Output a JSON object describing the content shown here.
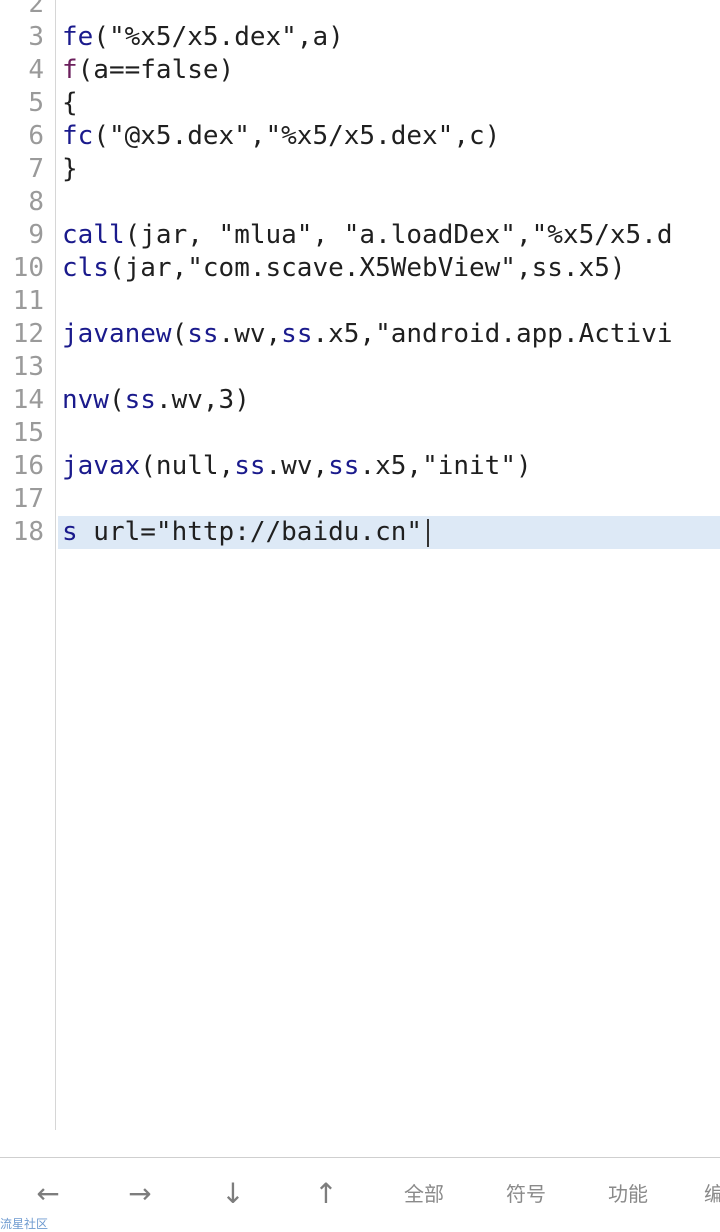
{
  "editor": {
    "lines": [
      {
        "n": "2",
        "tokens": [
          {
            "t": "",
            "c": ""
          }
        ]
      },
      {
        "n": "3",
        "tokens": [
          {
            "t": "fe",
            "c": "kw"
          },
          {
            "t": "(\"%x5/x5.dex\",a)",
            "c": ""
          }
        ]
      },
      {
        "n": "4",
        "tokens": [
          {
            "t": "f",
            "c": "kw2"
          },
          {
            "t": "(a==false)",
            "c": ""
          }
        ]
      },
      {
        "n": "5",
        "tokens": [
          {
            "t": "{",
            "c": ""
          }
        ]
      },
      {
        "n": "6",
        "tokens": [
          {
            "t": "fc",
            "c": "kw"
          },
          {
            "t": "(\"@x5.dex\",\"%x5/x5.dex\",c)",
            "c": ""
          }
        ]
      },
      {
        "n": "7",
        "tokens": [
          {
            "t": "}",
            "c": ""
          }
        ]
      },
      {
        "n": "8",
        "tokens": [
          {
            "t": "",
            "c": ""
          }
        ]
      },
      {
        "n": "9",
        "tokens": [
          {
            "t": "call",
            "c": "kw"
          },
          {
            "t": "(jar, \"mlua\", \"a.loadDex\",\"%x5/x5.d",
            "c": ""
          }
        ]
      },
      {
        "n": "10",
        "tokens": [
          {
            "t": "cls",
            "c": "kw"
          },
          {
            "t": "(jar,\"com.scave.X5WebView\",ss.x5)",
            "c": ""
          }
        ]
      },
      {
        "n": "11",
        "tokens": [
          {
            "t": "",
            "c": ""
          }
        ]
      },
      {
        "n": "12",
        "tokens": [
          {
            "t": "javanew",
            "c": "kw"
          },
          {
            "t": "(",
            "c": ""
          },
          {
            "t": "ss",
            "c": "kw"
          },
          {
            "t": ".wv,",
            "c": ""
          },
          {
            "t": "ss",
            "c": "kw"
          },
          {
            "t": ".x5,\"android.app.Activi",
            "c": ""
          }
        ]
      },
      {
        "n": "13",
        "tokens": [
          {
            "t": "",
            "c": ""
          }
        ]
      },
      {
        "n": "14",
        "tokens": [
          {
            "t": "nvw",
            "c": "kw"
          },
          {
            "t": "(",
            "c": ""
          },
          {
            "t": "ss",
            "c": "kw"
          },
          {
            "t": ".wv,3)",
            "c": ""
          }
        ]
      },
      {
        "n": "15",
        "tokens": [
          {
            "t": "",
            "c": ""
          }
        ]
      },
      {
        "n": "16",
        "tokens": [
          {
            "t": "javax",
            "c": "kw"
          },
          {
            "t": "(null,",
            "c": ""
          },
          {
            "t": "ss",
            "c": "kw"
          },
          {
            "t": ".wv,",
            "c": ""
          },
          {
            "t": "ss",
            "c": "kw"
          },
          {
            "t": ".x5,\"init\")",
            "c": ""
          }
        ]
      },
      {
        "n": "17",
        "tokens": [
          {
            "t": "",
            "c": ""
          }
        ]
      },
      {
        "n": "18",
        "current": true,
        "tokens": [
          {
            "t": "s",
            "c": "kw"
          },
          {
            "t": " url=\"http://baidu.cn\"",
            "c": ""
          }
        ]
      }
    ]
  },
  "toolbar": {
    "left_arrow": "←",
    "right_arrow": "→",
    "down_arrow": "↓",
    "up_arrow": "↑",
    "all_label": "全部",
    "symbol_label": "符号",
    "function_label": "功能",
    "partial_label": "编"
  },
  "watermark": {
    "text": "流星社区"
  }
}
